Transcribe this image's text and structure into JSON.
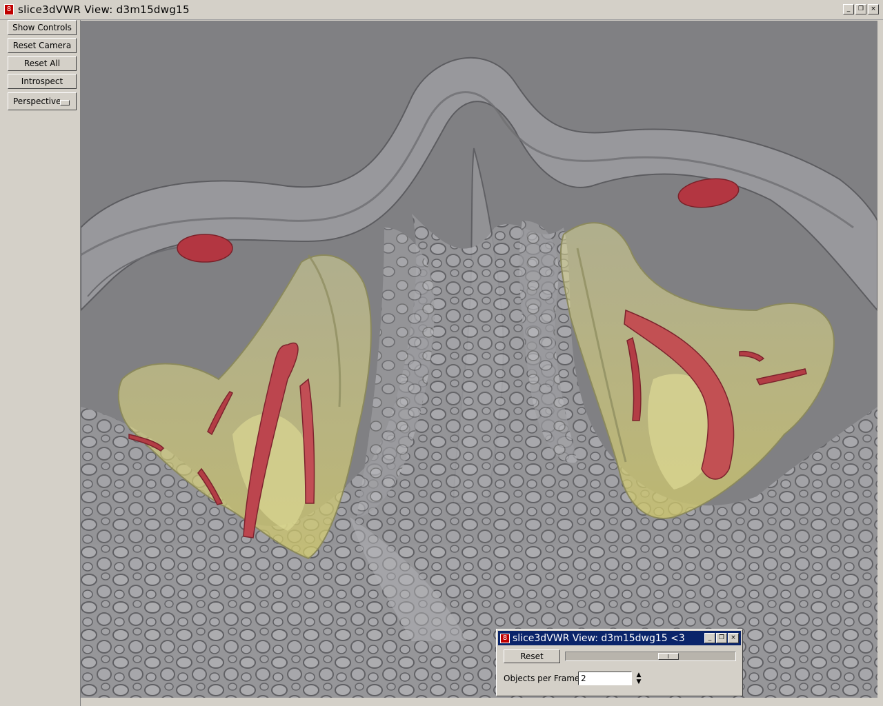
{
  "window": {
    "title": "slice3dVWR View: d3m15dwg15",
    "icon_text": "8",
    "controls": [
      "_",
      "❐",
      "×"
    ]
  },
  "left_panel": {
    "buttons": [
      "Show Controls",
      "Reset Camera",
      "Reset All",
      "Introspect"
    ],
    "projection_menu": "Perspective"
  },
  "viewport": {
    "background_color": "#808084",
    "render": "3D volume render of transparent gray bone surfaces with yellow and red structures"
  },
  "sub_window": {
    "title": "slice3dVWR View: d3m15dwg15 <3",
    "reset_label": "Reset",
    "slider_value": 0.62,
    "objects_per_frame_label": "Objects per Frame",
    "objects_per_frame_value": "2"
  },
  "colors": {
    "title_active": "#0a246a",
    "panel": "#d4d0c8",
    "bone": "#a9a9ac",
    "yellow": "#d8d68c",
    "red": "#c03a44"
  }
}
